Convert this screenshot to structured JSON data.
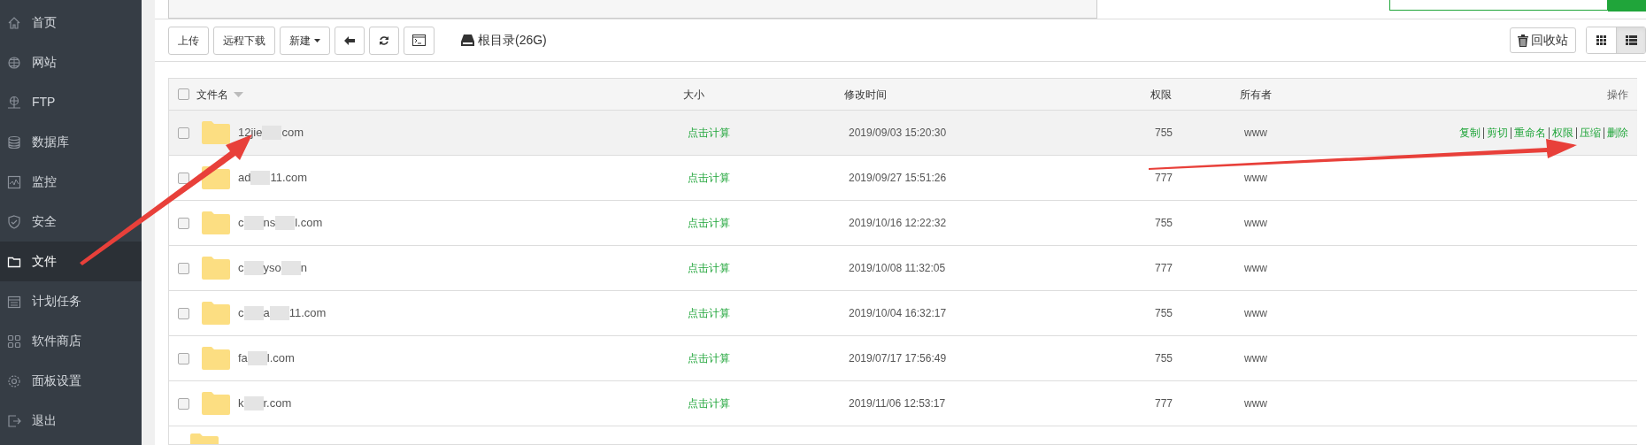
{
  "sidebar": {
    "items": [
      {
        "label": "首页",
        "selected": false
      },
      {
        "label": "网站",
        "selected": false
      },
      {
        "label": "FTP",
        "selected": false
      },
      {
        "label": "数据库",
        "selected": false
      },
      {
        "label": "监控",
        "selected": false
      },
      {
        "label": "安全",
        "selected": false
      },
      {
        "label": "文件",
        "selected": true
      },
      {
        "label": "计划任务",
        "selected": false
      },
      {
        "label": "软件商店",
        "selected": false
      },
      {
        "label": "面板设置",
        "selected": false
      },
      {
        "label": "退出",
        "selected": false
      }
    ]
  },
  "toolbar": {
    "buttons": [
      {
        "kind": "text",
        "label": "上传"
      },
      {
        "kind": "text",
        "label": "远程下载"
      },
      {
        "kind": "dropdown",
        "label": "新建"
      },
      {
        "kind": "back"
      },
      {
        "kind": "refresh"
      },
      {
        "kind": "terminal"
      }
    ],
    "disk_label": "根目录(26G)",
    "recycle_label": "回收站",
    "view_modes": [
      {
        "kind": "grid",
        "selected": false
      },
      {
        "kind": "list",
        "selected": true
      }
    ]
  },
  "table": {
    "select_all_checked": false,
    "columns": [
      "文件名",
      "大小",
      "修改时间",
      "权限",
      "所有者",
      "操作"
    ],
    "rows": [
      {
        "checked": false,
        "name_parts": [
          "12jie",
          "com"
        ],
        "size": "点击计算",
        "modified": "2019/09/03 15:20:30",
        "permission": "755",
        "owner": "www",
        "hovered": true,
        "actions": [
          "复制",
          "剪切",
          "重命名",
          "权限",
          "压缩",
          "删除"
        ]
      },
      {
        "checked": false,
        "name_parts": [
          "ad",
          "11.com"
        ],
        "size": "点击计算",
        "modified": "2019/09/27 15:51:26",
        "permission": "777",
        "owner": "www"
      },
      {
        "checked": false,
        "name_parts": [
          "c",
          "ns",
          "l.com"
        ],
        "size": "点击计算",
        "modified": "2019/10/16 12:22:32",
        "permission": "755",
        "owner": "www"
      },
      {
        "checked": false,
        "name_parts": [
          "c",
          "yso",
          "n"
        ],
        "size": "点击计算",
        "modified": "2019/10/08 11:32:05",
        "permission": "777",
        "owner": "www"
      },
      {
        "checked": false,
        "name_parts": [
          "c",
          "a",
          "11.com"
        ],
        "size": "点击计算",
        "modified": "2019/10/04 16:32:17",
        "permission": "755",
        "owner": "www"
      },
      {
        "checked": false,
        "name_parts": [
          "fa",
          "l.com"
        ],
        "size": "点击计算",
        "modified": "2019/07/17 17:56:49",
        "permission": "755",
        "owner": "www"
      },
      {
        "checked": false,
        "name_parts": [
          "k",
          "r.com"
        ],
        "size": "点击计算",
        "modified": "2019/11/06 12:53:17",
        "permission": "777",
        "owner": "www"
      }
    ]
  }
}
